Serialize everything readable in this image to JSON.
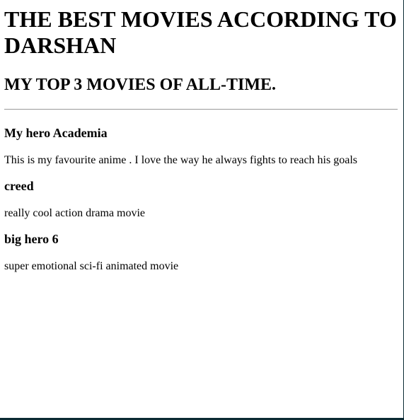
{
  "header": {
    "title": "THE BEST MOVIES ACCORDING TO DARSHAN",
    "subtitle": "MY TOP 3 MOVIES OF ALL-TIME."
  },
  "movies": [
    {
      "title": "My hero Academia",
      "description": "This is my favourite anime . I love the way he always fights to reach his goals"
    },
    {
      "title": "creed",
      "description": "really cool action drama movie"
    },
    {
      "title": "big hero 6",
      "description": "super emotional sci-fi animated movie"
    }
  ]
}
